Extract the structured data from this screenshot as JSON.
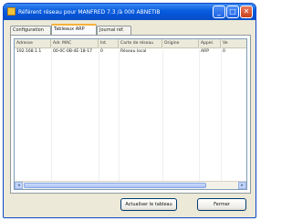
{
  "window": {
    "title": "Référent réseau pour MANFRED 7.3 /à 000 ABNETIB",
    "min_glyph": "_",
    "max_glyph": "□",
    "close_glyph": "✕"
  },
  "tabs": [
    {
      "label": "Configuration"
    },
    {
      "label": "Tableaux ARP",
      "active": true
    },
    {
      "label": "Journal réf."
    }
  ],
  "table": {
    "columns": [
      "Adresse",
      "Adr. MAC",
      "Int.",
      "Carte de réseau",
      "Origine",
      "Appel.",
      "Ve"
    ],
    "rows": [
      [
        "192.168.1.1",
        "00-0C-0B-4E-18-17",
        "0",
        "Réseau local",
        "",
        "ARP",
        "0"
      ]
    ]
  },
  "buttons": {
    "refresh": "Actualiser le tableau",
    "close": "Fermer"
  },
  "colors": {
    "titlebar": "#0553d6",
    "window_bg": "#ece9d8",
    "active_tab_accent": "#f6b23c",
    "close_button": "#c7411c"
  }
}
